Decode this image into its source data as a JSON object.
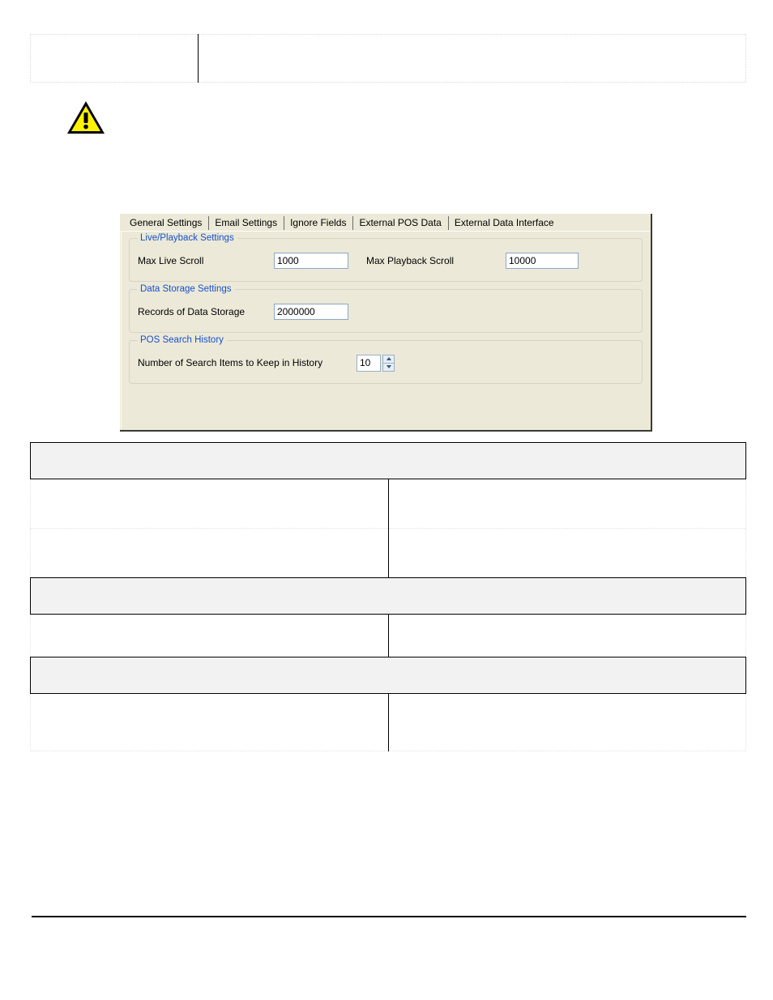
{
  "page": {
    "warning_icon": "warning-triangle-icon"
  },
  "top_table": {
    "rows": [
      {
        "left": "",
        "right": ""
      }
    ]
  },
  "dialog": {
    "tabs": [
      {
        "label": "General Settings",
        "active": true
      },
      {
        "label": "Email Settings",
        "active": false
      },
      {
        "label": "Ignore Fields",
        "active": false
      },
      {
        "label": "External POS Data",
        "active": false
      },
      {
        "label": "External Data Interface",
        "active": false
      }
    ],
    "accent_color": "#1550CF",
    "background_color": "#ECE9D8",
    "groups": [
      {
        "title": "Live/Playback Settings",
        "fields": [
          {
            "label": "Max Live Scroll",
            "value": "1000",
            "placeholder": ""
          },
          {
            "label": "Max Playback Scroll",
            "value": "10000",
            "placeholder": ""
          }
        ]
      },
      {
        "title": "Data Storage Settings",
        "fields": [
          {
            "label": "Records of Data Storage",
            "value": "2000000",
            "placeholder": ""
          }
        ]
      },
      {
        "title": "POS Search History",
        "fields": [
          {
            "label": "Number of Search Items to Keep in History",
            "value": "10",
            "placeholder": ""
          }
        ]
      }
    ]
  },
  "bottom_table": {
    "rows": [
      {
        "type": "section",
        "text": ""
      },
      {
        "type": "data",
        "left": "",
        "right": ""
      },
      {
        "type": "data",
        "left": "",
        "right": ""
      },
      {
        "type": "section",
        "text": ""
      },
      {
        "type": "data",
        "left": "",
        "right": ""
      },
      {
        "type": "section",
        "text": ""
      },
      {
        "type": "data",
        "left": "",
        "right": ""
      }
    ]
  }
}
